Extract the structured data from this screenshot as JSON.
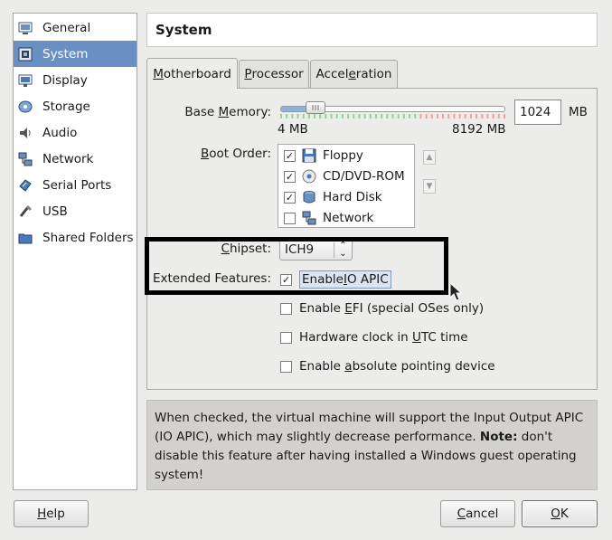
{
  "sidebar": {
    "items": [
      {
        "label": "General",
        "icon": "general-icon",
        "selected": false
      },
      {
        "label": "System",
        "icon": "system-icon",
        "selected": true
      },
      {
        "label": "Display",
        "icon": "display-icon",
        "selected": false
      },
      {
        "label": "Storage",
        "icon": "storage-icon",
        "selected": false
      },
      {
        "label": "Audio",
        "icon": "audio-icon",
        "selected": false
      },
      {
        "label": "Network",
        "icon": "network-icon",
        "selected": false
      },
      {
        "label": "Serial Ports",
        "icon": "serial-ports-icon",
        "selected": false
      },
      {
        "label": "USB",
        "icon": "usb-icon",
        "selected": false
      },
      {
        "label": "Shared Folders",
        "icon": "shared-folders-icon",
        "selected": false
      }
    ]
  },
  "header": {
    "title": "System"
  },
  "tabs": [
    {
      "pre": "",
      "key": "M",
      "post": "otherboard",
      "active": true
    },
    {
      "pre": "",
      "key": "P",
      "post": "rocessor",
      "active": false
    },
    {
      "pre": "Accel",
      "key": "e",
      "post": "ration",
      "active": false
    }
  ],
  "motherboard": {
    "base_memory": {
      "label_pre": "Base ",
      "label_key": "M",
      "label_post": "emory:",
      "value": "1024",
      "unit": "MB",
      "min_label": "4 MB",
      "max_label": "8192 MB",
      "level_fraction": 0.125
    },
    "boot_order": {
      "label_pre": "",
      "label_key": "B",
      "label_post": "oot Order:",
      "items": [
        {
          "label": "Floppy",
          "checked": true,
          "icon": "floppy-icon"
        },
        {
          "label": "CD/DVD-ROM",
          "checked": true,
          "icon": "cd-dvd-icon"
        },
        {
          "label": "Hard Disk",
          "checked": true,
          "icon": "hard-disk-icon"
        },
        {
          "label": "Network",
          "checked": false,
          "icon": "network-boot-icon"
        }
      ]
    },
    "chipset": {
      "label_pre": "",
      "label_key": "C",
      "label_post": "hipset:",
      "value": "ICH9"
    },
    "extended_features": {
      "label": "Extended Features:",
      "options": [
        {
          "pre": "Enable ",
          "key": "I",
          "post": "O APIC",
          "checked": true
        },
        {
          "pre": "Enable ",
          "key": "E",
          "post": "FI (special OSes only)",
          "checked": false
        },
        {
          "pre": "Hardware clock in ",
          "key": "U",
          "post": "TC time",
          "checked": false
        },
        {
          "pre": "Enable ",
          "key": "a",
          "post": "bsolute pointing device",
          "checked": false
        }
      ]
    }
  },
  "description": {
    "text1": "When checked, the virtual machine will support the Input Output APIC (IO APIC), which may slightly decrease performance. ",
    "note": "Note:",
    "text2": " don't disable this feature after having installed a Windows guest operating system!"
  },
  "buttons": {
    "help": {
      "key": "H",
      "post": "elp"
    },
    "cancel": {
      "key": "C",
      "post": "ancel"
    },
    "ok": {
      "key": "O",
      "post": "K"
    }
  },
  "colors": {
    "selection": "#6a8fc2",
    "slider_green": "#8fd48f",
    "slider_red": "#f0a0a0"
  }
}
